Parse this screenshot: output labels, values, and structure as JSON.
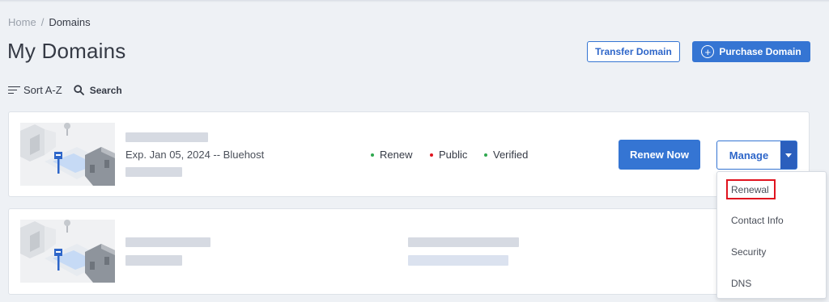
{
  "breadcrumb": {
    "home": "Home",
    "separator": "/",
    "current": "Domains"
  },
  "page": {
    "title": "My Domains"
  },
  "header_actions": {
    "transfer_label": "Transfer Domain",
    "purchase_label": "Purchase Domain",
    "purchase_icon": "plus-circle-icon"
  },
  "toolbar": {
    "sort_label": "Sort A-Z",
    "search_label": "Search"
  },
  "domains": [
    {
      "expiration": "Exp. Jan 05, 2024 -- Bluehost",
      "statuses": [
        {
          "label": "Renew",
          "color": "#2fa84f"
        },
        {
          "label": "Public",
          "color": "#e0141f"
        },
        {
          "label": "Verified",
          "color": "#2fa84f"
        }
      ],
      "renew_label": "Renew Now",
      "manage_label": "Manage"
    },
    {}
  ],
  "manage_menu": {
    "items": [
      "Renewal",
      "Contact Info",
      "Security",
      "DNS"
    ],
    "highlighted": "Renewal",
    "highlight_color": "#e0141f"
  },
  "colors": {
    "primary": "#3575d3",
    "background": "#eef1f5"
  }
}
